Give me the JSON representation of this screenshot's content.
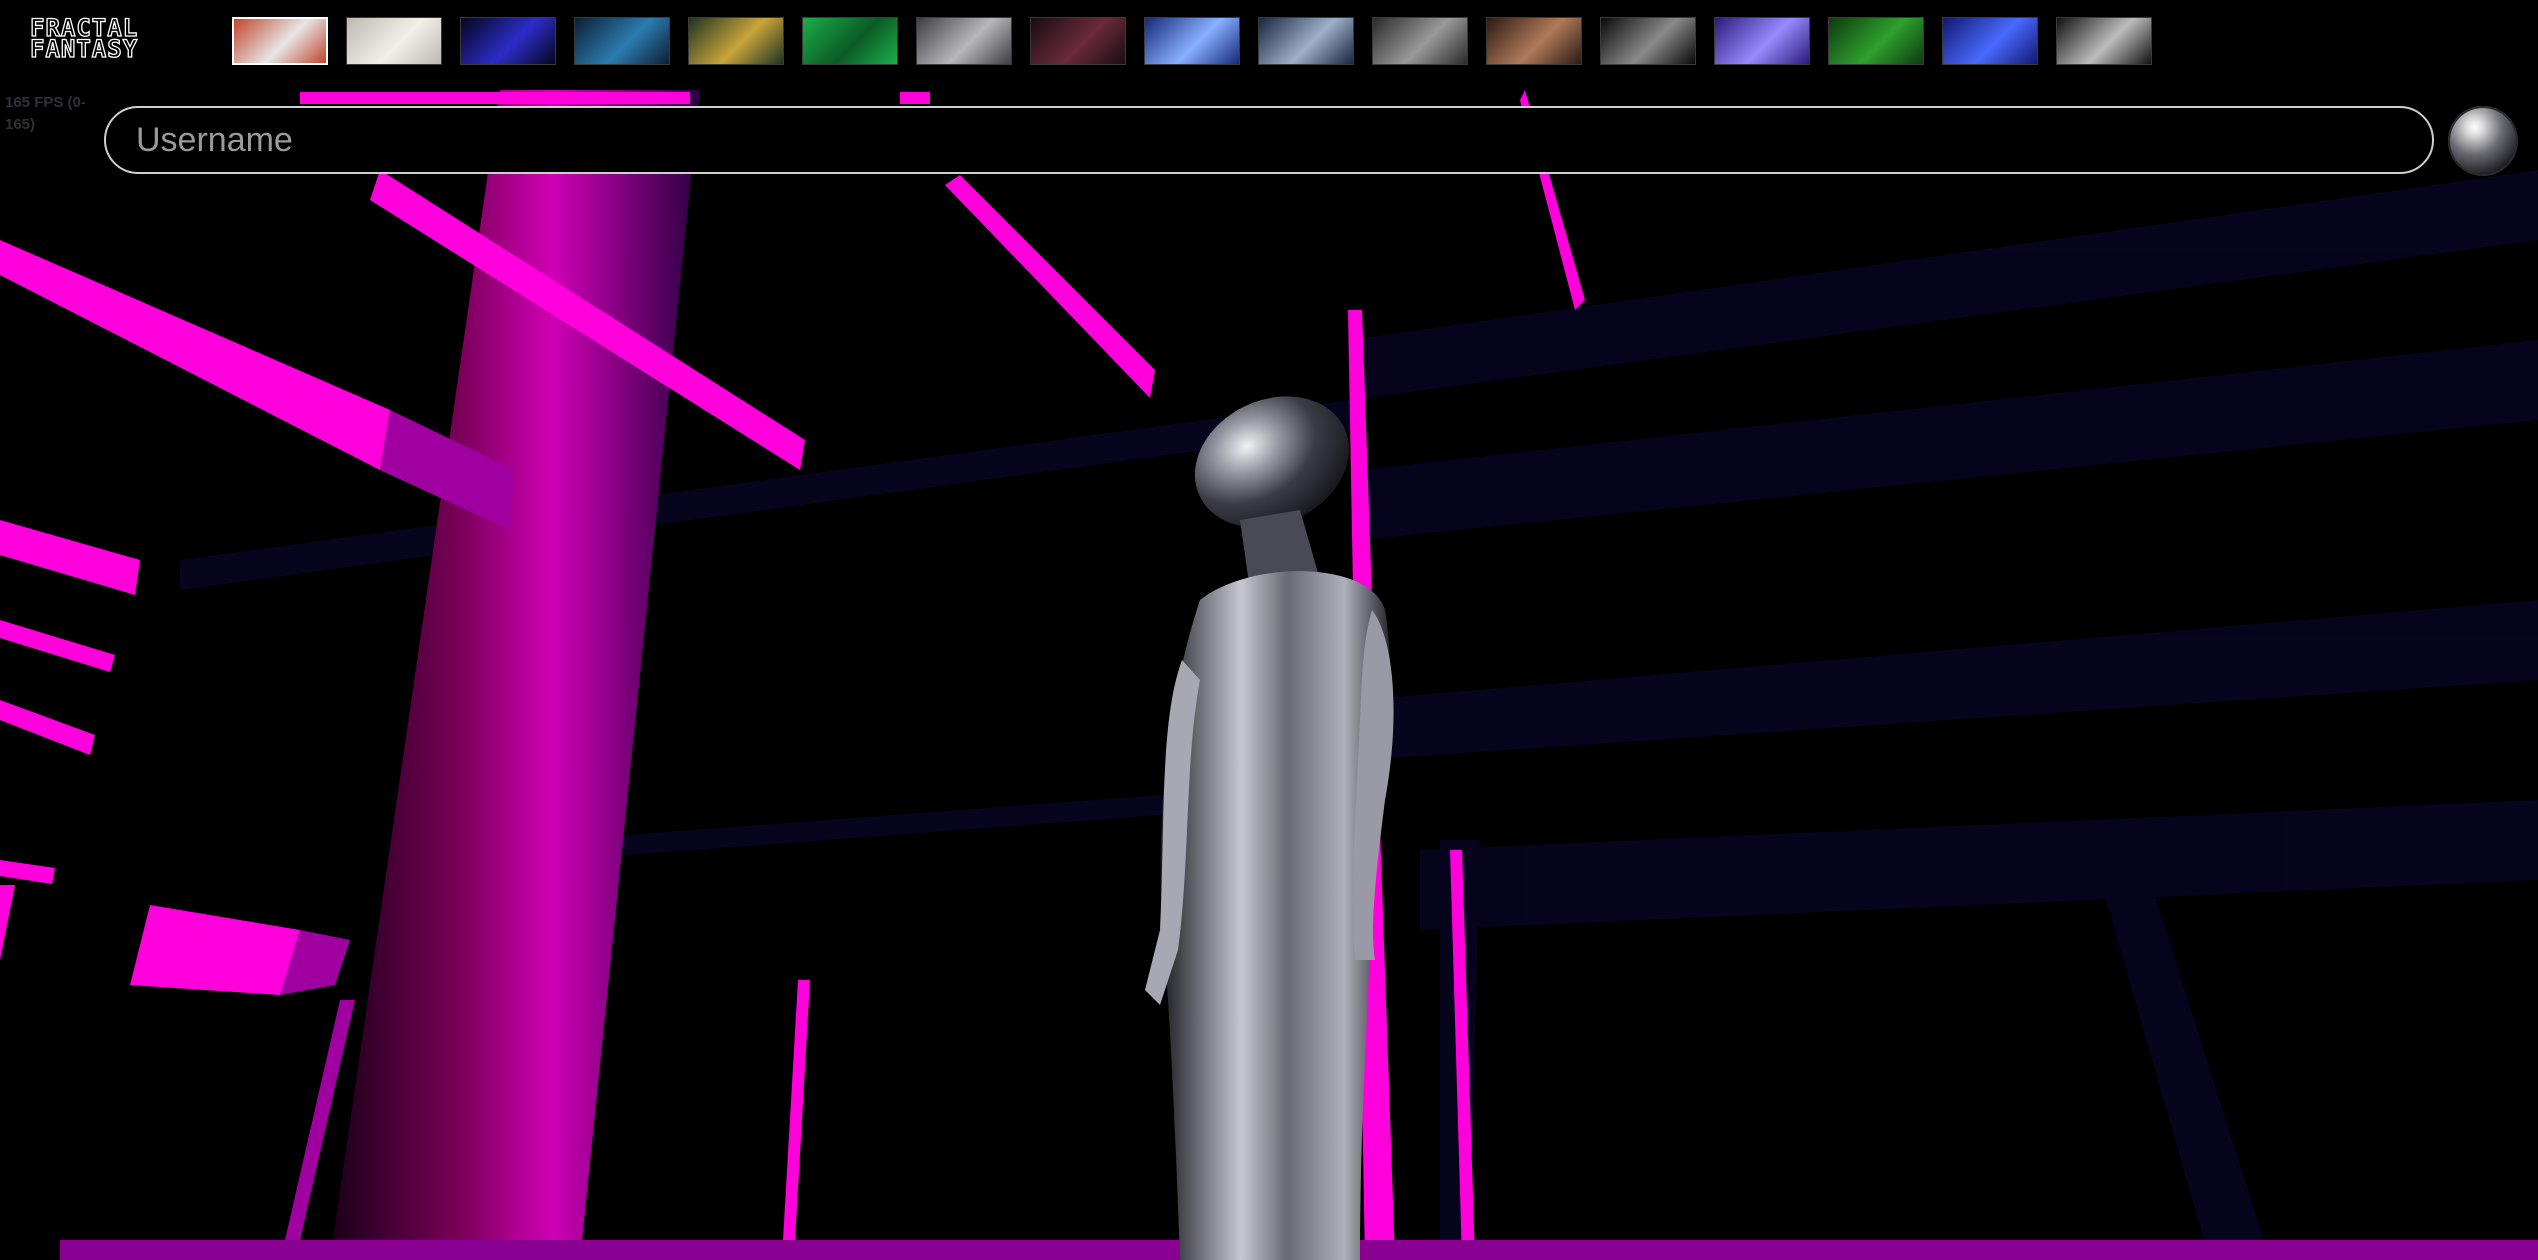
{
  "app": {
    "logo_line1": "FRACTAL",
    "logo_line2": "FANTASY"
  },
  "overlay": {
    "fps_text": "165 FPS (0-165)"
  },
  "login": {
    "username_placeholder": "Username",
    "username_value": ""
  },
  "colors": {
    "accent": "#ff00dd",
    "background": "#000000",
    "floor_blue": "#050018"
  },
  "rooms": [
    {
      "name": "room-1",
      "bg": "#c0452a",
      "fg": "#e6e6e6",
      "active": true
    },
    {
      "name": "room-2",
      "bg": "#bdb8b2",
      "fg": "#f2efe9",
      "active": false
    },
    {
      "name": "room-3",
      "bg": "#06061c",
      "fg": "#2c2cc8",
      "active": false
    },
    {
      "name": "room-4",
      "bg": "#0c1f33",
      "fg": "#2b7cb0",
      "active": false
    },
    {
      "name": "room-5",
      "bg": "#1e3322",
      "fg": "#c9a53a",
      "active": false
    },
    {
      "name": "room-6",
      "bg": "#1cae4c",
      "fg": "#0b5a24",
      "active": false
    },
    {
      "name": "room-7",
      "bg": "#3d3d42",
      "fg": "#b8b8bc",
      "active": false
    },
    {
      "name": "room-8",
      "bg": "#180c12",
      "fg": "#6a2a3a",
      "active": false
    },
    {
      "name": "room-9",
      "bg": "#16287a",
      "fg": "#8ab0ff",
      "active": false
    },
    {
      "name": "room-10",
      "bg": "#18263e",
      "fg": "#9fb0c8",
      "active": false
    },
    {
      "name": "room-11",
      "bg": "#2a2a2a",
      "fg": "#9a9a9a",
      "active": false
    },
    {
      "name": "room-12",
      "bg": "#2a1a12",
      "fg": "#b07a5a",
      "active": false
    },
    {
      "name": "room-13",
      "bg": "#0a0a0a",
      "fg": "#8a8a8a",
      "active": false
    },
    {
      "name": "room-14",
      "bg": "#2a1a7a",
      "fg": "#9a8aff",
      "active": false
    },
    {
      "name": "room-15",
      "bg": "#0e3a10",
      "fg": "#2fa02f",
      "active": false
    },
    {
      "name": "room-16",
      "bg": "#101870",
      "fg": "#4a6aff",
      "active": false
    },
    {
      "name": "room-17",
      "bg": "#121212",
      "fg": "#bdbdbd",
      "active": false
    }
  ]
}
